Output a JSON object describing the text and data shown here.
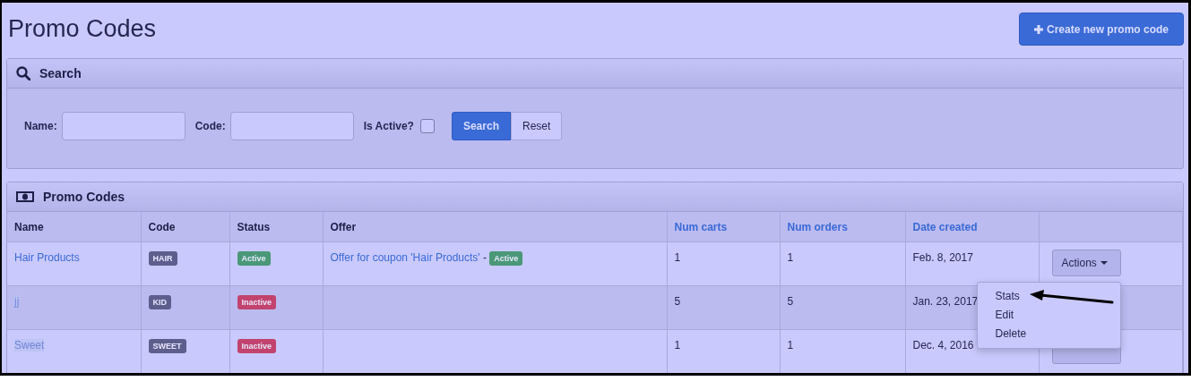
{
  "page_title": "Promo Codes",
  "create_button": {
    "label": "Create new promo code"
  },
  "search_panel": {
    "title": "Search",
    "fields": [
      {
        "label": "Name:"
      },
      {
        "label": "Code:"
      }
    ],
    "is_active": {
      "label": "Is Active?",
      "checked": false
    },
    "buttons": [
      {
        "label": "Search",
        "kind": "primary"
      },
      {
        "label": "Reset",
        "kind": "default"
      }
    ]
  },
  "table": {
    "title": "Promo Codes",
    "columns": [
      {
        "label": "Name",
        "sortable": false
      },
      {
        "label": "Code",
        "sortable": false
      },
      {
        "label": "Status",
        "sortable": false
      },
      {
        "label": "Offer",
        "sortable": false
      },
      {
        "label": "Num carts",
        "sortable": true
      },
      {
        "label": "Num orders",
        "sortable": true
      },
      {
        "label": "Date created",
        "sortable": true
      }
    ],
    "rows": [
      {
        "name": "Hair Products",
        "blurred": false,
        "code": "HAIR",
        "status": {
          "label": "Active",
          "kind": "active"
        },
        "offer": {
          "link": "Offer for coupon 'Hair Products'",
          "separator": "-",
          "badge": {
            "label": "Active",
            "kind": "active"
          }
        },
        "num_carts": "1",
        "num_orders": "1",
        "date_created": "Feb. 8, 2017",
        "actions": {
          "menu_open": true
        }
      },
      {
        "name": "jj",
        "blurred": true,
        "code": "KID",
        "status": {
          "label": "Inactive",
          "kind": "inactive"
        },
        "num_carts": "5",
        "num_orders": "5",
        "date_created": "Jan. 23, 2017"
      },
      {
        "name": "Sweet",
        "blurred": true,
        "code": "SWEET",
        "status": {
          "label": "Inactive",
          "kind": "inactive"
        },
        "num_carts": "1",
        "num_orders": "1",
        "date_created": "Dec. 4, 2016",
        "actions": {
          "menu_open": false
        }
      }
    ]
  },
  "actions_menu": {
    "button_label": "Actions",
    "items": [
      "Stats",
      "Edit",
      "Delete"
    ]
  }
}
